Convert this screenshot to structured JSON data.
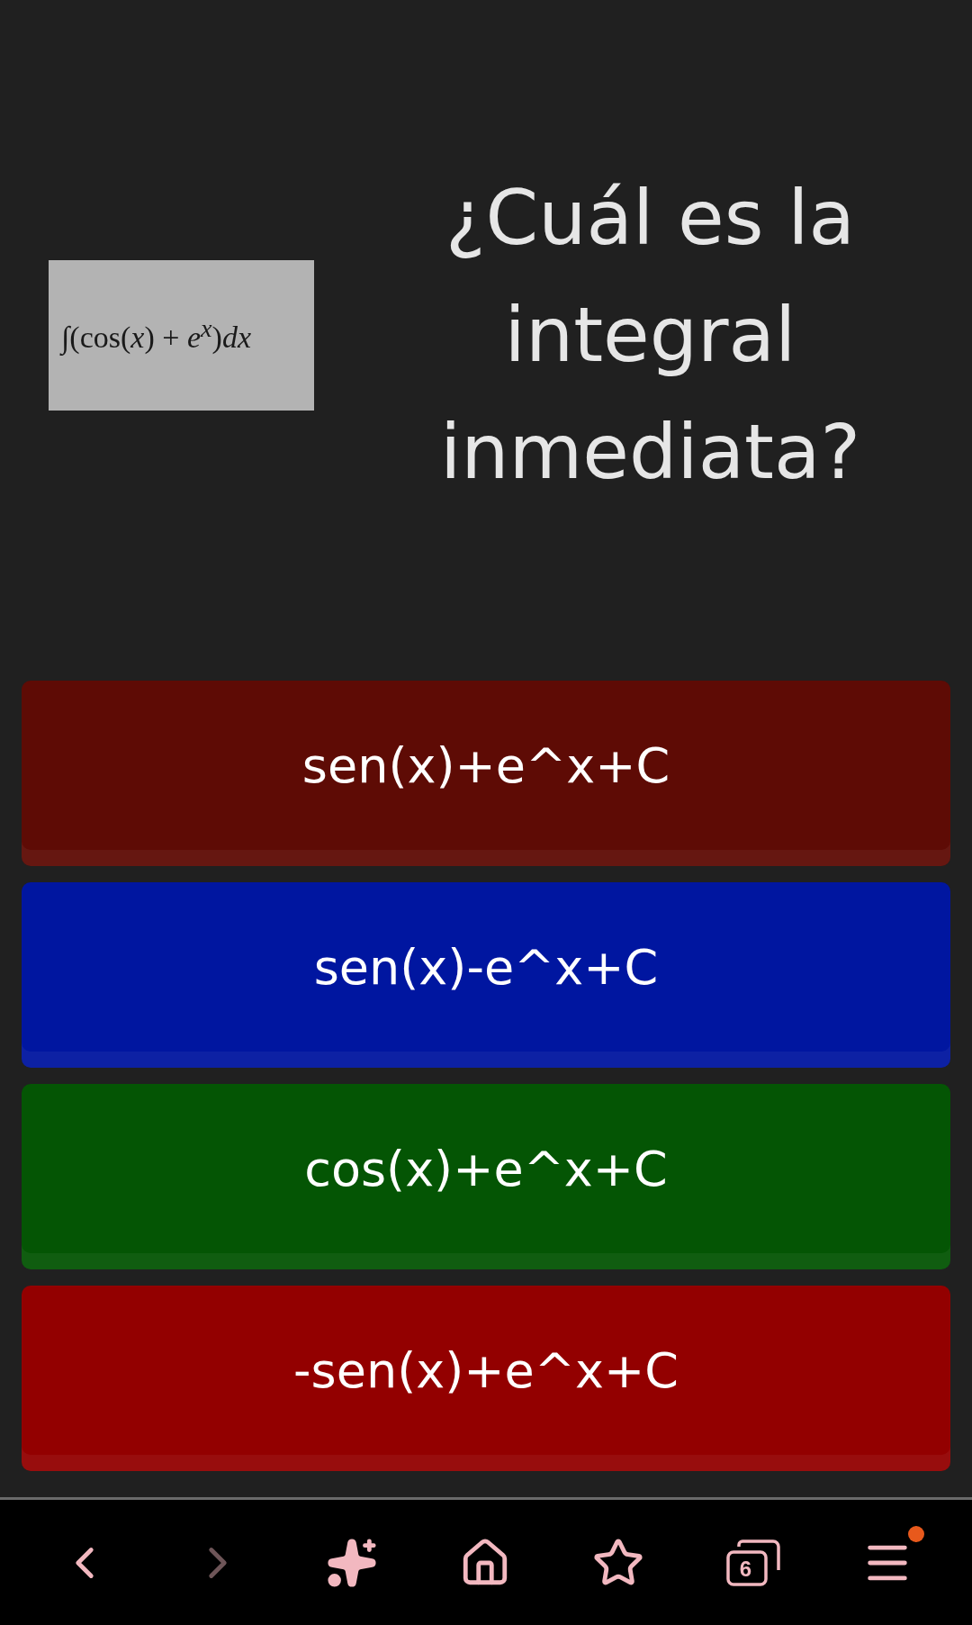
{
  "question": {
    "formula": "∫(cos(*x*) + *e*$^{x}$)*dx*",
    "text": "¿Cuál es la integral inmediata?"
  },
  "answers": [
    {
      "label": "sen(x)+e^x+C",
      "color": "#5e0b05"
    },
    {
      "label": "sen(x)-e^x+C",
      "color": "#0016a0"
    },
    {
      "label": "cos(x)+e^x+C",
      "color": "#045504"
    },
    {
      "label": "-sen(x)+e^x+C",
      "color": "#930000"
    }
  ],
  "nav_bar": [
    {
      "kind": "back",
      "disabled": false
    },
    {
      "kind": "forward",
      "disabled": true
    },
    {
      "kind": "assistant",
      "disabled": false
    },
    {
      "kind": "home",
      "disabled": false
    },
    {
      "kind": "bookmarks",
      "disabled": false
    },
    {
      "kind": "tabs",
      "disabled": false,
      "count": "6"
    },
    {
      "kind": "menu",
      "disabled": false,
      "notification": true
    }
  ]
}
